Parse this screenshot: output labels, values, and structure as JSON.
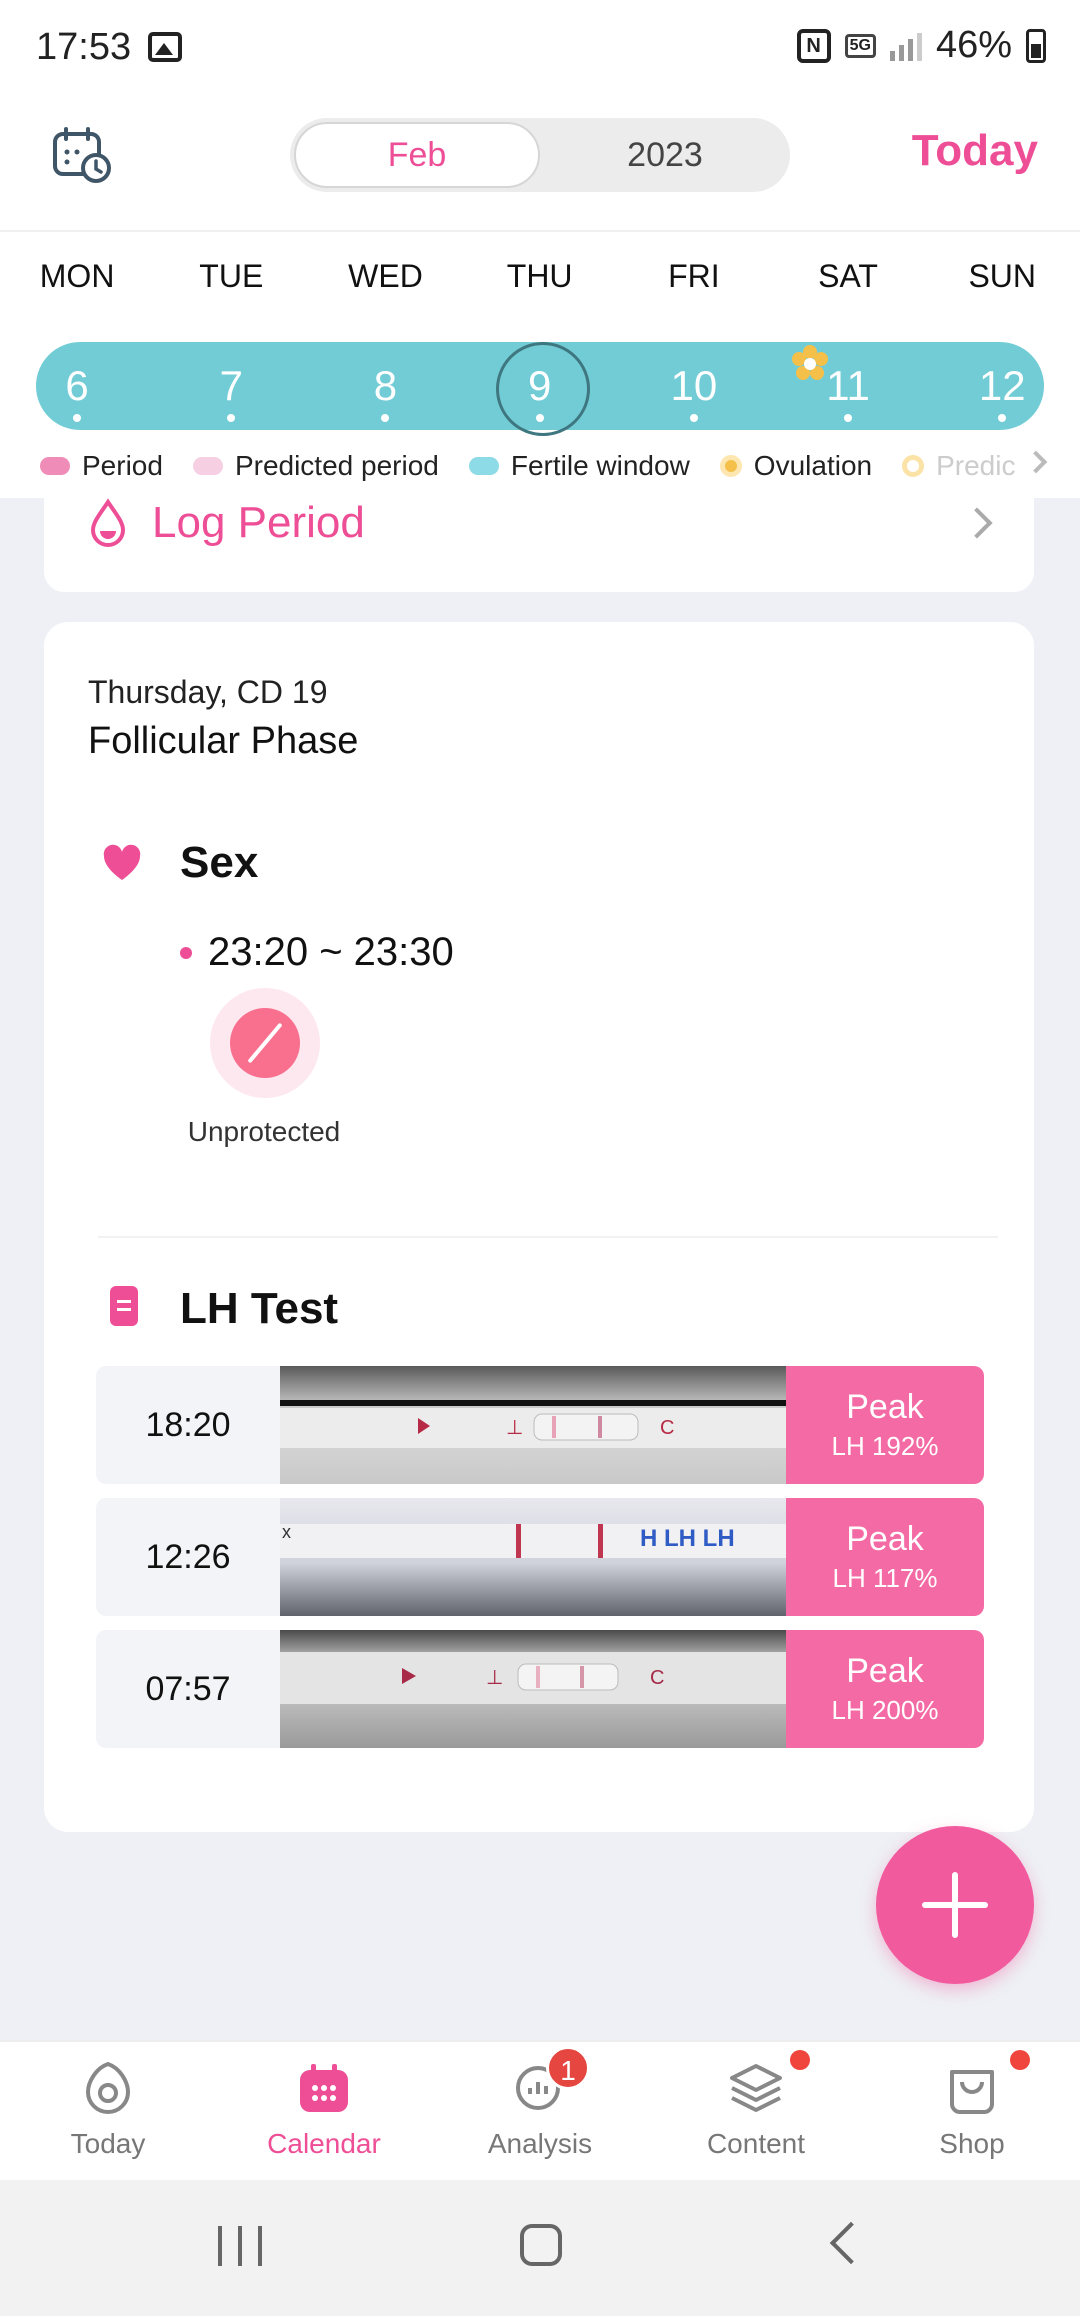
{
  "status_bar": {
    "time": "17:53",
    "net_label": "5G",
    "battery": "46%"
  },
  "header": {
    "month": "Feb",
    "year": "2023",
    "today_label": "Today"
  },
  "week": {
    "days": [
      "MON",
      "TUE",
      "WED",
      "THU",
      "FRI",
      "SAT",
      "SUN"
    ],
    "dates": [
      "6",
      "7",
      "8",
      "9",
      "10",
      "11",
      "12"
    ],
    "selected_date": "9"
  },
  "legend": {
    "period": "Period",
    "predicted_period": "Predicted period",
    "fertile_window": "Fertile window",
    "ovulation": "Ovulation",
    "predicted_ovulation": "Predic"
  },
  "log_period": {
    "label": "Log Period"
  },
  "day_info": {
    "day_label": "Thursday, CD 19",
    "phase": "Follicular Phase"
  },
  "sex": {
    "title": "Sex",
    "time_range": "23:20 ~ 23:30",
    "protection": "Unprotected"
  },
  "lh_test": {
    "title": "LH Test",
    "entries": [
      {
        "time": "18:20",
        "result": "Peak",
        "lh": "LH 192%"
      },
      {
        "time": "12:26",
        "result": "Peak",
        "lh": "LH 117%"
      },
      {
        "time": "07:57",
        "result": "Peak",
        "lh": "LH 200%"
      }
    ]
  },
  "bottom_nav": {
    "today": "Today",
    "calendar": "Calendar",
    "analysis": "Analysis",
    "analysis_badge": "1",
    "content": "Content",
    "shop": "Shop"
  },
  "colors": {
    "accent": "#ee4e96",
    "fertile": "#72ccd6",
    "peak": "#f46aa4",
    "period": "#f08cb8",
    "predicted_period": "#f6d0e2",
    "fertile_legend": "#8ddbe6",
    "ovulation": "#f5c04a"
  }
}
